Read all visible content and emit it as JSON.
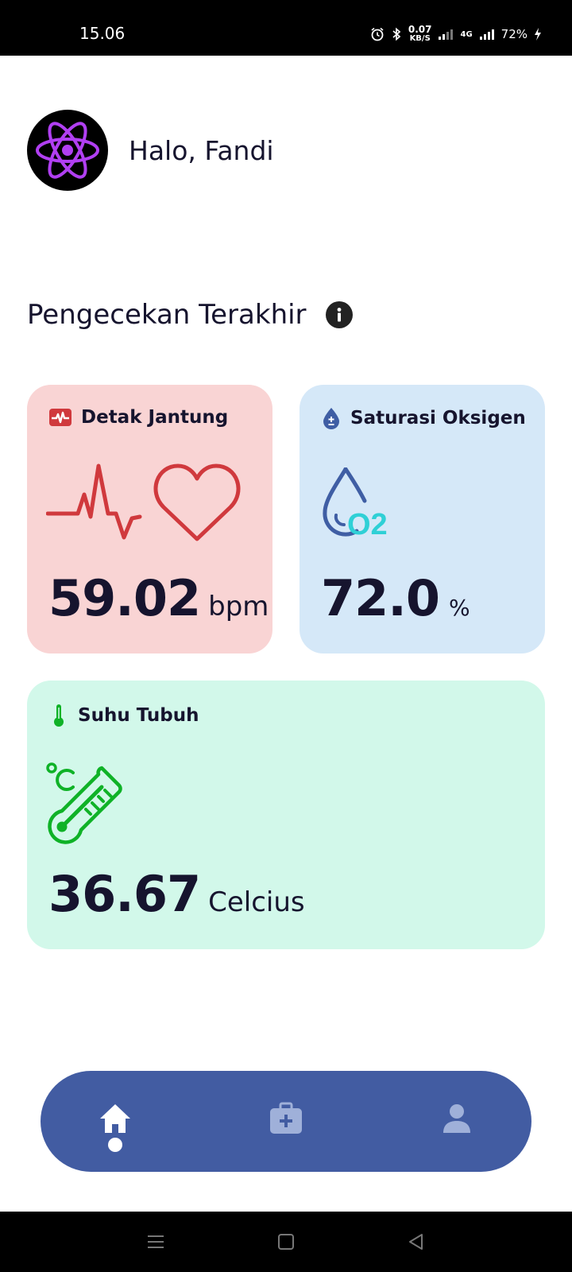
{
  "status_bar": {
    "time": "15.06",
    "speed_value": "0.07",
    "speed_unit": "KB/S",
    "network": "4G",
    "battery": "72%"
  },
  "header": {
    "greeting": "Halo, Fandi",
    "avatar_icon": "react-atom-icon"
  },
  "section": {
    "title": "Pengecekan Terakhir",
    "info_icon": "info-icon"
  },
  "cards": {
    "heart_rate": {
      "label": "Detak Jantung",
      "value": "59.02",
      "unit": "bpm",
      "color": "#f9d4d4",
      "accent": "#d0393d"
    },
    "oxygen": {
      "label": "Saturasi Oksigen",
      "value": "72.0",
      "unit": "%",
      "color": "#d5e8f8",
      "accent": "#3f5ea4"
    },
    "temperature": {
      "label": "Suhu Tubuh",
      "value": "36.67",
      "unit": "Celcius",
      "color": "#d2f8ea",
      "accent": "#0fb227"
    }
  },
  "nav": {
    "items": [
      {
        "name": "home",
        "icon": "home-icon",
        "active": true
      },
      {
        "name": "medical",
        "icon": "medical-kit-icon",
        "active": false
      },
      {
        "name": "profile",
        "icon": "user-icon",
        "active": false
      }
    ],
    "color": "#425ca2"
  }
}
